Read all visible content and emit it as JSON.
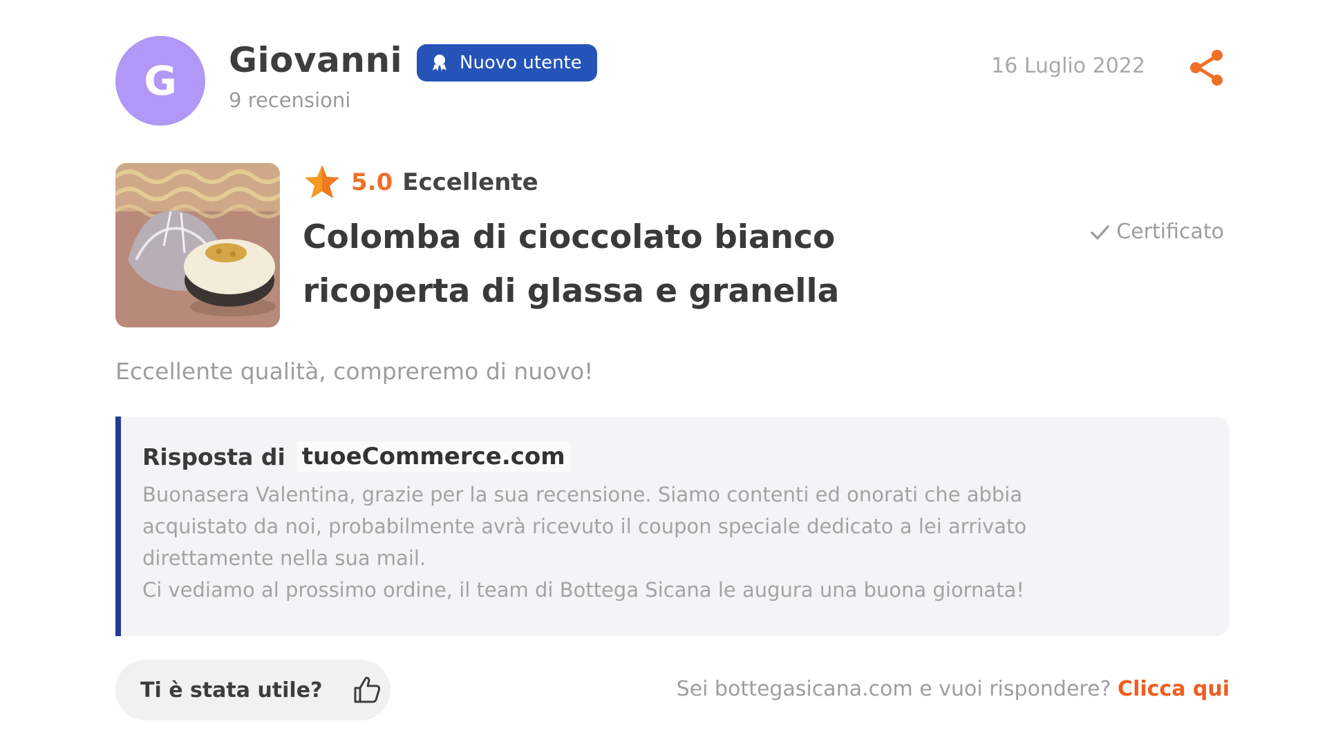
{
  "user": {
    "initial": "G",
    "name": "Giovanni",
    "badge_label": "Nuovo utente",
    "review_count": "9 recensioni"
  },
  "review": {
    "date": "16 Luglio 2022",
    "rating_value": "5.0",
    "rating_label": "Eccellente",
    "product_title": "Colomba di cioccolato bianco ricoperta di glassa e granella",
    "certified_label": "Certificato",
    "text": "Eccellente qualità, compreremo di nuovo!"
  },
  "reply": {
    "label": "Risposta di",
    "shop": "tuoeCommerce.com",
    "lines": [
      "Buonasera Valentina, grazie per la sua recensione. Siamo contenti ed onorati che abbia",
      "acquistato da noi, probabilmente avrà ricevuto il coupon speciale dedicato a lei arrivato",
      "direttamente nella sua mail.",
      "Ci vediamo al prossimo ordine, il team di Bottega Sicana le augura una buona giornata!"
    ]
  },
  "footer": {
    "helpful_label": "Ti è stata utile?",
    "reply_prompt": "Sei bottegasicana.com e vuoi rispondere?",
    "reply_link": "Clicca qui"
  },
  "icons": {
    "badge": "user-badge-icon",
    "share": "share-icon",
    "star": "star-icon",
    "certified": "check-icon",
    "helpful": "thumbs-up-icon"
  },
  "colors": {
    "avatar_bg": "#b198f6",
    "badge_bg": "#2553b8",
    "accent_orange": "#ef6f27",
    "reply_border": "#213c97",
    "reply_bg": "#f3f4f6"
  }
}
